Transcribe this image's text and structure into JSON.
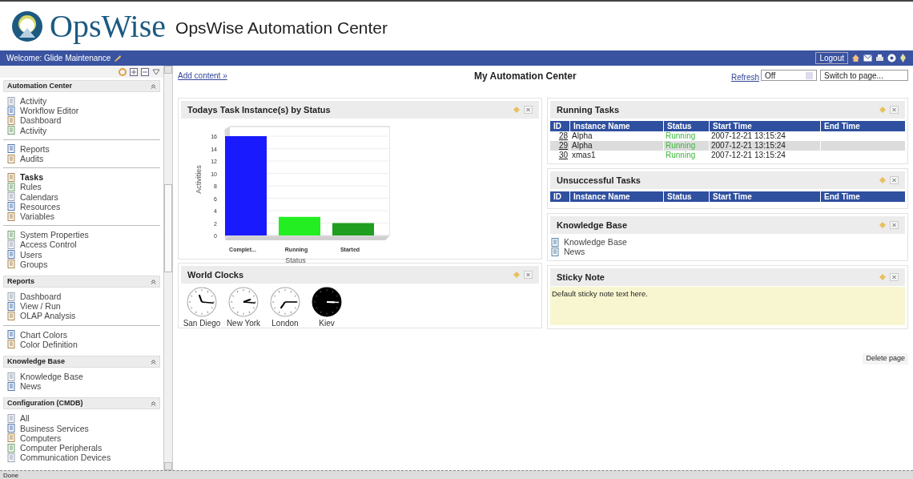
{
  "header": {
    "logo_text": "OpsWise",
    "title": "OpsWise Automation Center"
  },
  "user_bar": {
    "welcome": "Welcome: Glide Maintenance",
    "logout": "Logout"
  },
  "sidebar": {
    "sections": [
      {
        "title": "Automation Center",
        "groups": [
          [
            {
              "label": "Activity",
              "selected": false
            },
            {
              "label": "Workflow Editor",
              "selected": false
            },
            {
              "label": "Dashboard",
              "selected": false
            },
            {
              "label": "Activity",
              "selected": false
            }
          ],
          [
            {
              "label": "Reports",
              "selected": false
            },
            {
              "label": "Audits",
              "selected": false
            }
          ],
          [
            {
              "label": "Tasks",
              "selected": true
            },
            {
              "label": "Rules",
              "selected": false
            },
            {
              "label": "Calendars",
              "selected": false
            },
            {
              "label": "Resources",
              "selected": false
            },
            {
              "label": "Variables",
              "selected": false
            }
          ],
          [
            {
              "label": "System Properties",
              "selected": false
            },
            {
              "label": "Access Control",
              "selected": false
            },
            {
              "label": "Users",
              "selected": false
            },
            {
              "label": "Groups",
              "selected": false
            }
          ]
        ]
      },
      {
        "title": "Reports",
        "groups": [
          [
            {
              "label": "Dashboard",
              "selected": false
            },
            {
              "label": "View / Run",
              "selected": false
            },
            {
              "label": "OLAP Analysis",
              "selected": false
            }
          ],
          [
            {
              "label": "Chart Colors",
              "selected": false
            },
            {
              "label": "Color Definition",
              "selected": false
            }
          ]
        ]
      },
      {
        "title": "Knowledge Base",
        "groups": [
          [
            {
              "label": "Knowledge Base",
              "selected": false
            },
            {
              "label": "News",
              "selected": false
            }
          ]
        ]
      },
      {
        "title": "Configuration (CMDB)",
        "groups": [
          [
            {
              "label": "All",
              "selected": false
            },
            {
              "label": "Business Services",
              "selected": false
            },
            {
              "label": "Computers",
              "selected": false
            },
            {
              "label": "Computer Peripherals",
              "selected": false
            },
            {
              "label": "Communication Devices",
              "selected": false
            }
          ]
        ]
      }
    ]
  },
  "toolbar": {
    "add_content": "Add content »",
    "page_title": "My Automation Center",
    "refresh_label": "Refresh",
    "refresh_value": "Off",
    "switch_page": "Switch to page..."
  },
  "chart_panel": {
    "title": "Todays Task Instance(s) by Status",
    "chart_data": {
      "type": "bar",
      "xlabel": "Status",
      "ylabel": "Activities",
      "categories": [
        "Complet...",
        "Running",
        "Started"
      ],
      "values": [
        16,
        3,
        2
      ],
      "colors": [
        "#1a1aff",
        "#22ee22",
        "#1f9e1f"
      ],
      "grid": true,
      "ylim": [
        0,
        16
      ],
      "yticks": [
        0,
        2,
        4,
        6,
        8,
        10,
        12,
        14,
        16
      ]
    }
  },
  "clocks_panel": {
    "title": "World Clocks",
    "clocks": [
      {
        "city": "San Diego",
        "kind": "light"
      },
      {
        "city": "New York",
        "kind": "light"
      },
      {
        "city": "London",
        "kind": "light"
      },
      {
        "city": "Kiev",
        "kind": "dark"
      }
    ]
  },
  "running_tasks_panel": {
    "title": "Running Tasks",
    "columns": [
      "ID",
      "Instance Name",
      "Status",
      "Start Time",
      "End Time"
    ],
    "rows": [
      {
        "id": "28",
        "name": "Alpha",
        "status": "Running",
        "start": "2007-12-21 13:15:24"
      },
      {
        "id": "29",
        "name": "Alpha",
        "status": "Running",
        "start": "2007-12-21 13:15:24"
      },
      {
        "id": "30",
        "name": "xmas1",
        "status": "Running",
        "start": "2007-12-21 13:15:24"
      }
    ]
  },
  "unsuccessful_tasks_panel": {
    "title": "Unsuccessful Tasks",
    "columns": [
      "ID",
      "Instance Name",
      "Status",
      "Start Time",
      "End Time"
    ]
  },
  "knowledge_panel": {
    "title": "Knowledge Base",
    "links": [
      "Knowledge Base",
      "News"
    ]
  },
  "sticky_panel": {
    "title": "Sticky Note",
    "text": "Default sticky note text here."
  },
  "delete_page": "Delete page",
  "status_bar": "Done"
}
